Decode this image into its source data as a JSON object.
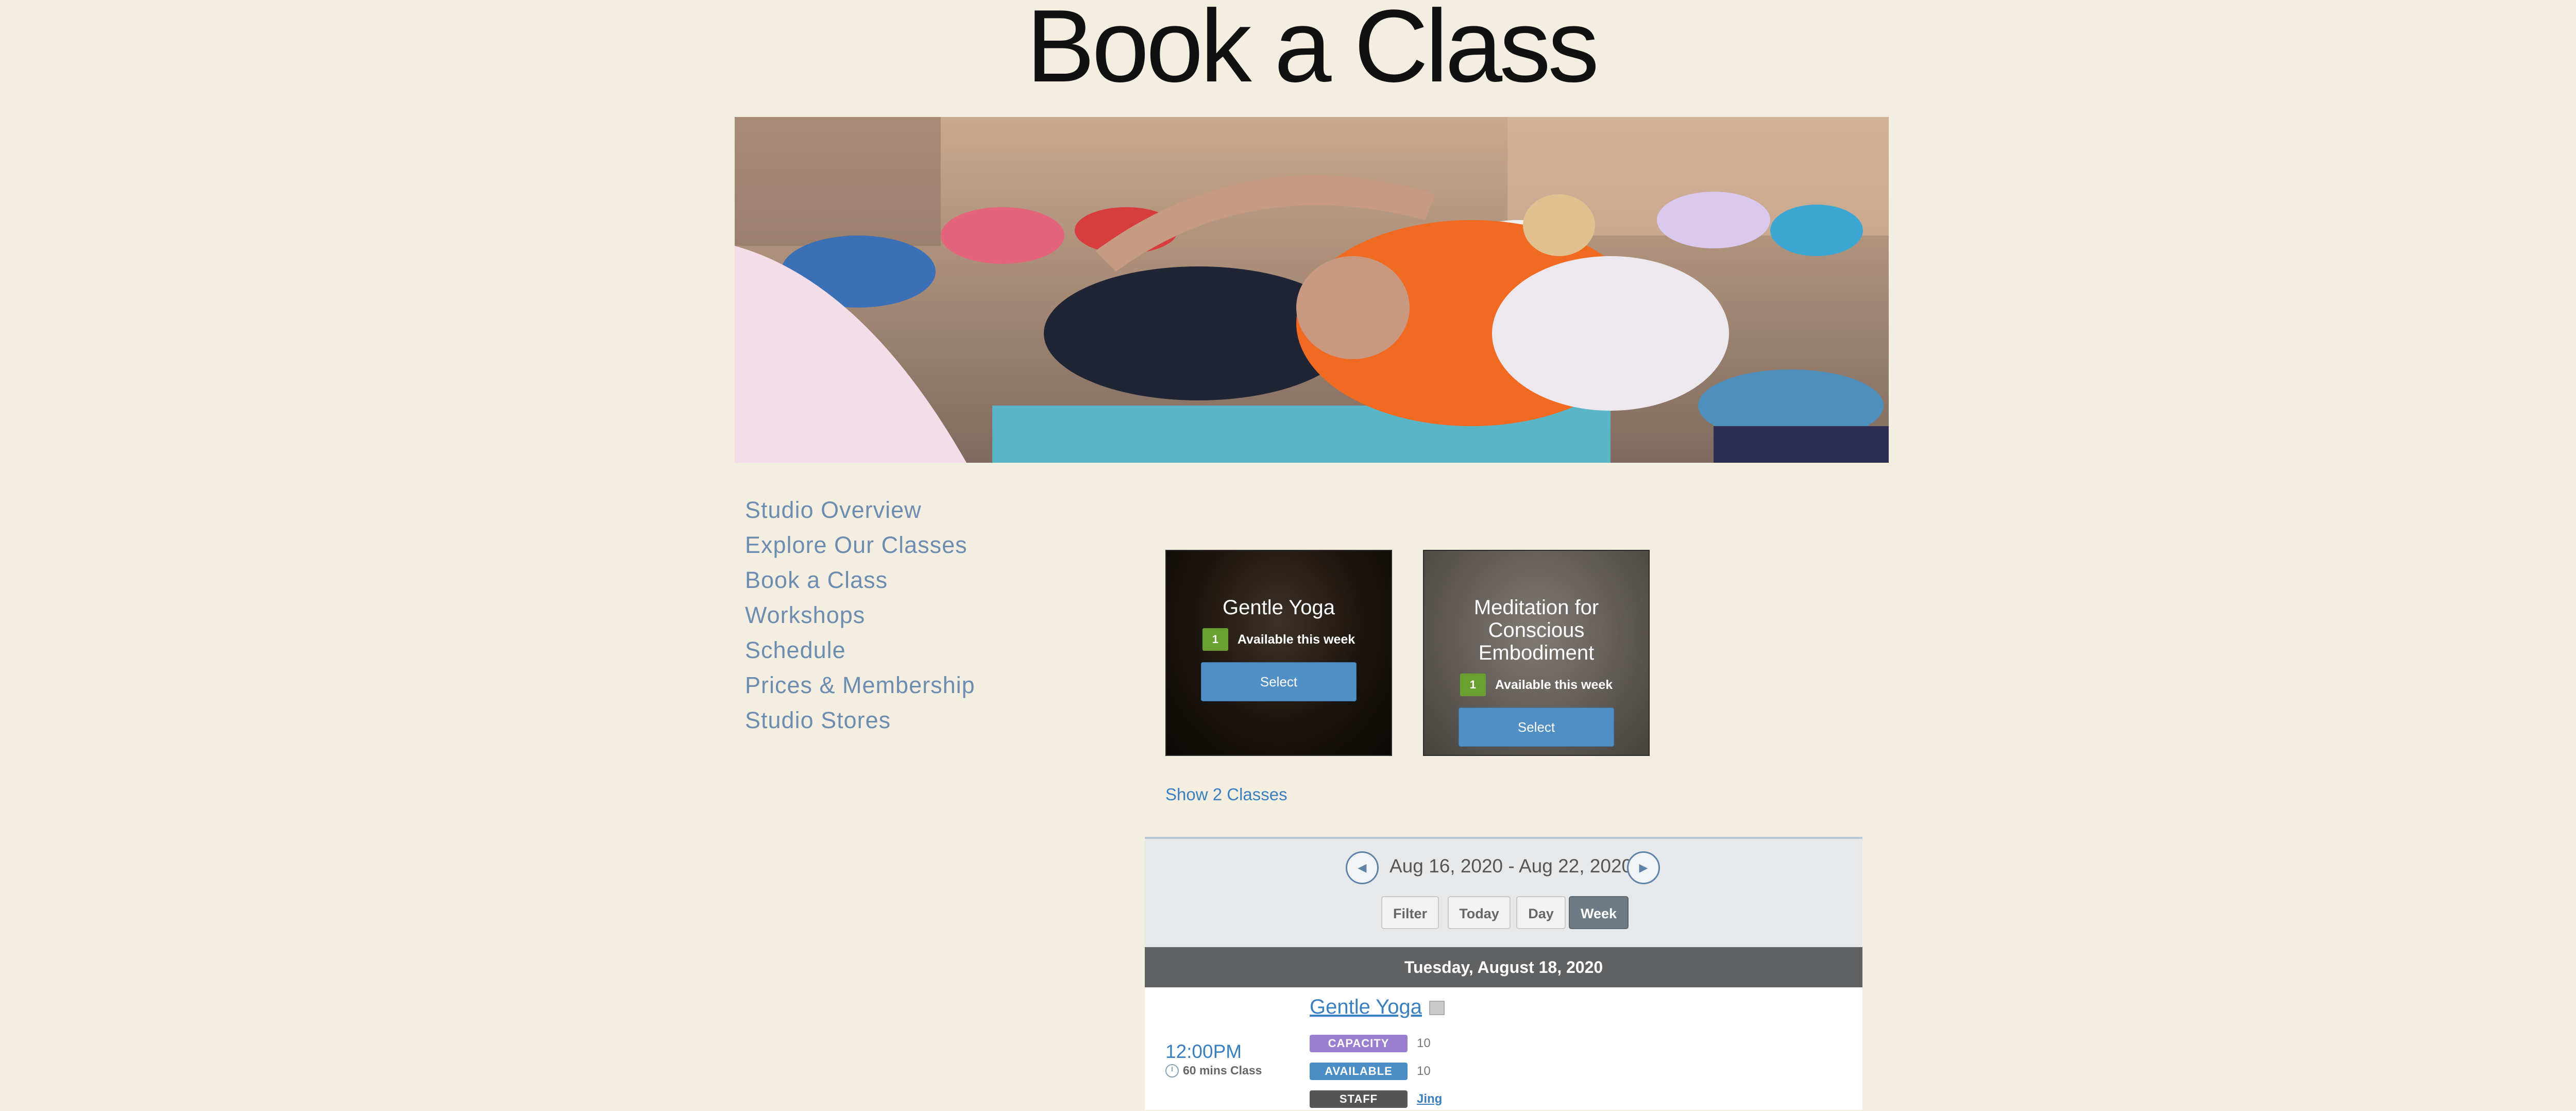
{
  "page": {
    "title": "Book a Class"
  },
  "nav": {
    "items": [
      "Studio Overview",
      "Explore Our Classes",
      "Book a Class",
      "Workshops",
      "Schedule",
      "Prices & Membership",
      "Studio Stores"
    ]
  },
  "classes": [
    {
      "name": "Gentle Yoga",
      "count": "1",
      "availability": "Available this week",
      "button": "Select"
    },
    {
      "name": "Meditation for Conscious Embodiment",
      "count": "1",
      "availability": "Available this week",
      "button": "Select"
    }
  ],
  "show_classes_link": "Show 2 Classes",
  "schedule": {
    "date_range": "Aug 16, 2020 - Aug 22, 2020",
    "prev_icon": "caret-left-icon",
    "next_icon": "caret-right-icon",
    "views": [
      "Filter",
      "Today",
      "Day",
      "Week"
    ],
    "active_view": "Week",
    "day_header": "Tuesday, August 18, 2020",
    "entry": {
      "time": "12:00PM",
      "duration": "60 mins Class",
      "class_name": "Gentle Yoga",
      "capacity_label": "CAPACITY",
      "capacity_value": "10",
      "available_label": "AVAILABLE",
      "available_value": "10",
      "staff_label": "STAFF",
      "staff_value": "Jing"
    }
  },
  "colors": {
    "background": "#f4eee1",
    "link": "#3a7fc0",
    "nav_link": "#6d8db0",
    "select_button": "#4f8fc4",
    "availability_count": "#6aa031",
    "capacity_badge": "#9a7fce",
    "available_badge": "#4b8ec5",
    "staff_badge": "#555555",
    "day_bar": "#5f6163"
  }
}
